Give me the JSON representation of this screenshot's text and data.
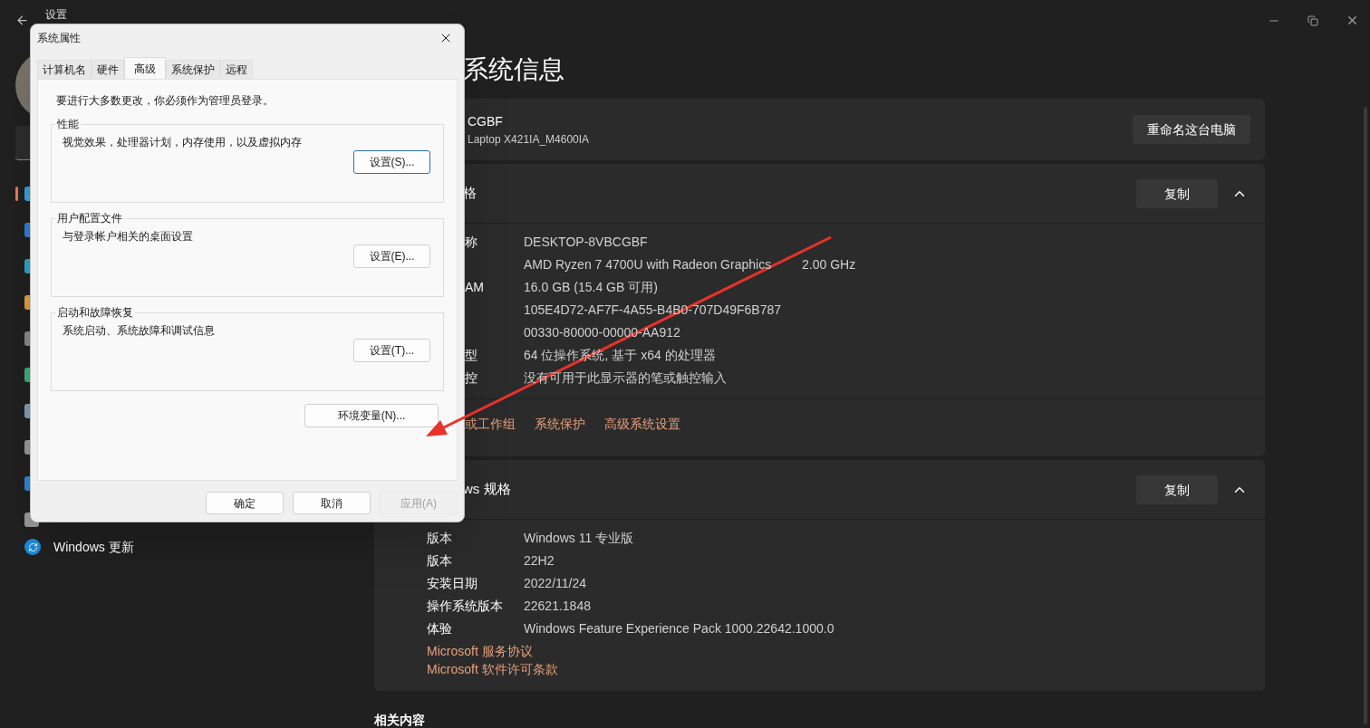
{
  "settings_window": {
    "title": "设置"
  },
  "sidebar": {
    "items": [
      {
        "label": "Windows 更新"
      }
    ]
  },
  "page_title": "系统信息",
  "device_card": {
    "name": "CGBF",
    "model": "Laptop X421IA_M4600IA",
    "rename_button": "重命名这台电脑"
  },
  "sections": [
    {
      "kind": "hardware",
      "title": "格",
      "copy_button": "复制",
      "expanded": true,
      "rows": [
        {
          "label": "称",
          "value": "DESKTOP-8VBCGBF"
        },
        {
          "value": "AMD Ryzen 7 4700U with Radeon Graphics",
          "extra": "2.00 GHz"
        },
        {
          "label": "AM",
          "value": "16.0 GB (15.4 GB 可用)"
        },
        {
          "value": "105E4D72-AF7F-4A55-B4B0-707D49F6B787"
        },
        {
          "value": "00330-80000-00000-AA912"
        },
        {
          "label": "型",
          "value": "64 位操作系统, 基于 x64 的处理器"
        },
        {
          "label": "控",
          "value": "没有可用于此显示器的笔或触控输入"
        }
      ],
      "links": [
        "或工作组",
        "系统保护",
        "高级系统设置"
      ]
    },
    {
      "kind": "software",
      "title": "ws 规格",
      "copy_button": "复制",
      "expanded": true,
      "rows": [
        {
          "label": "版本",
          "value": "Windows 11 专业版"
        },
        {
          "label": "版本",
          "value": "22H2"
        },
        {
          "label": "安装日期",
          "value": "2022/11/24"
        },
        {
          "label": "操作系统版本",
          "value": "22621.1848"
        },
        {
          "label": "体验",
          "value": "Windows Feature Experience Pack 1000.22642.1000.0"
        }
      ],
      "links": [
        "Microsoft 服务协议",
        "Microsoft 软件许可条款"
      ]
    }
  ],
  "related_heading": "相关内容",
  "dialog": {
    "title": "系统属性",
    "tabs": [
      {
        "label": "计算机名",
        "selected": false
      },
      {
        "label": "硬件",
        "selected": false
      },
      {
        "label": "高级",
        "selected": true
      },
      {
        "label": "系统保护",
        "selected": false
      },
      {
        "label": "远程",
        "selected": false
      }
    ],
    "notice": "要进行大多数更改，你必须作为管理员登录。",
    "groups": [
      {
        "title": "性能",
        "description": "视觉效果，处理器计划，内存使用，以及虚拟内存",
        "button": "设置(S)...",
        "focused": true
      },
      {
        "title": "用户配置文件",
        "description": "与登录帐户相关的桌面设置",
        "button": "设置(E)...",
        "focused": false
      },
      {
        "title": "启动和故障恢复",
        "description": "系统启动、系统故障和调试信息",
        "button": "设置(T)...",
        "focused": false
      }
    ],
    "env_button": "环境变量(N)...",
    "buttons": [
      {
        "label": "确定",
        "disabled": false
      },
      {
        "label": "取消",
        "disabled": false
      },
      {
        "label": "应用(A)",
        "disabled": true
      }
    ]
  }
}
